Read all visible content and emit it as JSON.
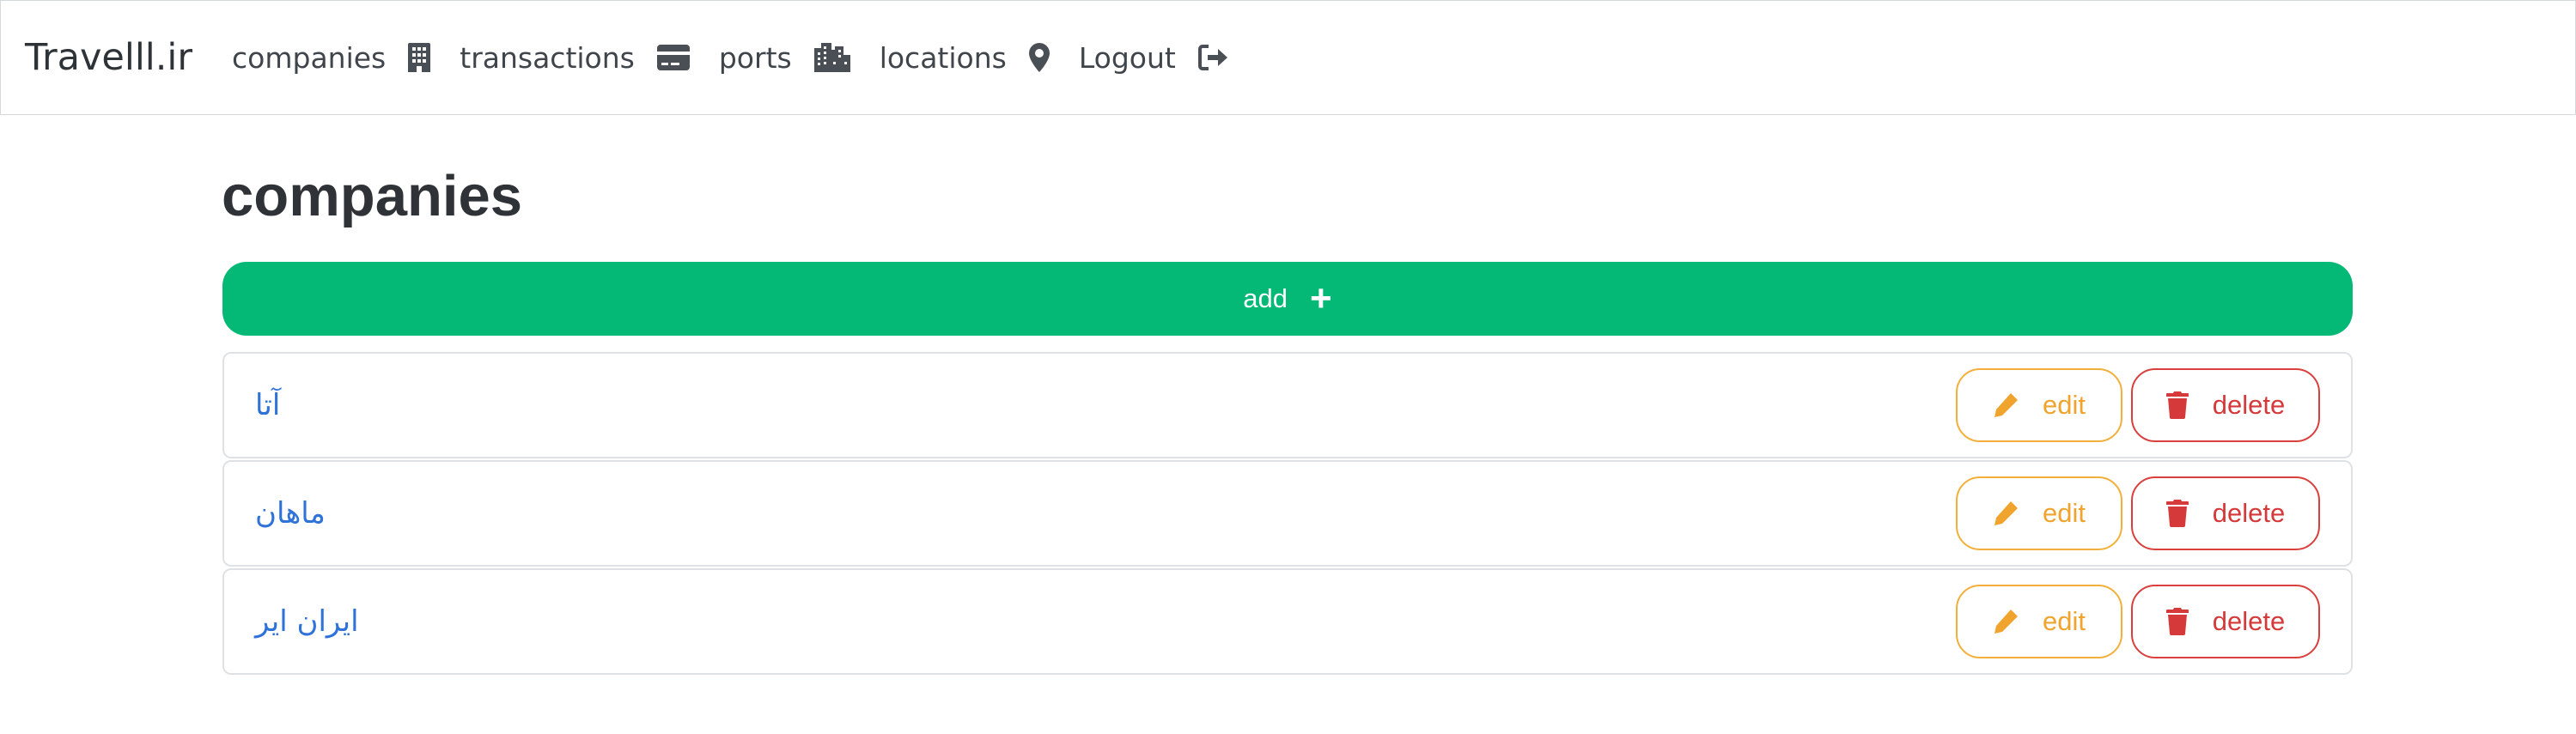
{
  "nav": {
    "brand": "Travelll.ir",
    "items": [
      {
        "label": "companies",
        "icon": "building-icon"
      },
      {
        "label": "transactions",
        "icon": "credit-card-icon"
      },
      {
        "label": "ports",
        "icon": "city-icon"
      },
      {
        "label": "locations",
        "icon": "map-marker-icon"
      },
      {
        "label": "Logout",
        "icon": "sign-out-icon"
      }
    ]
  },
  "page": {
    "title": "companies",
    "add_label": "add",
    "add_icon": "+"
  },
  "companies": [
    {
      "name": "آتا",
      "edit_label": "edit",
      "delete_label": "delete"
    },
    {
      "name": "ماهان",
      "edit_label": "edit",
      "delete_label": "delete"
    },
    {
      "name": "ایران ایر",
      "edit_label": "edit",
      "delete_label": "delete"
    }
  ],
  "colors": {
    "primary_green": "#03b975",
    "link_blue": "#2f72d8",
    "edit_orange": "#f0a42e",
    "delete_red": "#d5393a"
  }
}
